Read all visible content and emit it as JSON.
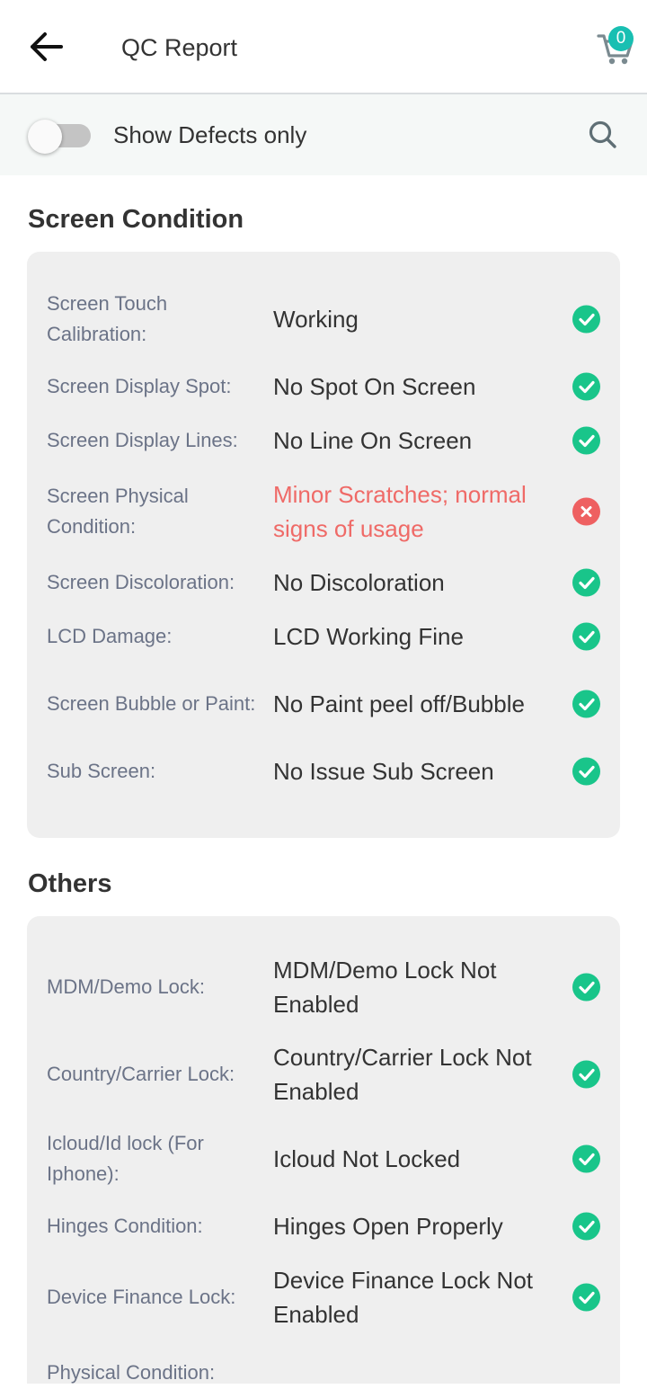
{
  "header": {
    "title": "QC Report",
    "cart_count": "0",
    "accent": "#19bfb2"
  },
  "filter": {
    "toggle_label": "Show Defects only",
    "toggle_on": false
  },
  "sections": [
    {
      "title": "Screen Condition",
      "items": [
        {
          "label": "Screen Touch Calibration:",
          "value": "Working",
          "status": "ok"
        },
        {
          "label": "Screen Display Spot:",
          "value": "No Spot On Screen",
          "status": "ok"
        },
        {
          "label": "Screen Display Lines:",
          "value": "No Line On Screen",
          "status": "ok"
        },
        {
          "label": "Screen Physical Condition:",
          "value": "Minor Scratches; normal signs of usage",
          "status": "defect"
        },
        {
          "label": "Screen Discoloration:",
          "value": "No Discoloration",
          "status": "ok"
        },
        {
          "label": "LCD Damage:",
          "value": "LCD Working Fine",
          "status": "ok"
        },
        {
          "label": "Screen Bubble or Paint:",
          "value": "No Paint peel off/Bubble",
          "status": "ok"
        },
        {
          "label": "Sub Screen:",
          "value": "No Issue Sub Screen",
          "status": "ok"
        }
      ]
    },
    {
      "title": "Others",
      "items": [
        {
          "label": "MDM/Demo Lock:",
          "value": "MDM/Demo Lock Not Enabled",
          "status": "ok"
        },
        {
          "label": "Country/Carrier Lock:",
          "value": "Country/Carrier Lock Not Enabled",
          "status": "ok"
        },
        {
          "label": "Icloud/Id lock (For Iphone):",
          "value": "Icloud Not Locked",
          "status": "ok"
        },
        {
          "label": "Hinges Condition:",
          "value": "Hinges Open Properly",
          "status": "ok"
        },
        {
          "label": "Device Finance Lock:",
          "value": "Device Finance Lock Not Enabled",
          "status": "ok"
        },
        {
          "label": "Physical Condition:",
          "value": "",
          "status": "ok"
        }
      ]
    }
  ],
  "colors": {
    "ok": "#19c58a",
    "defect": "#ef6a67",
    "label": "#6b7387"
  }
}
